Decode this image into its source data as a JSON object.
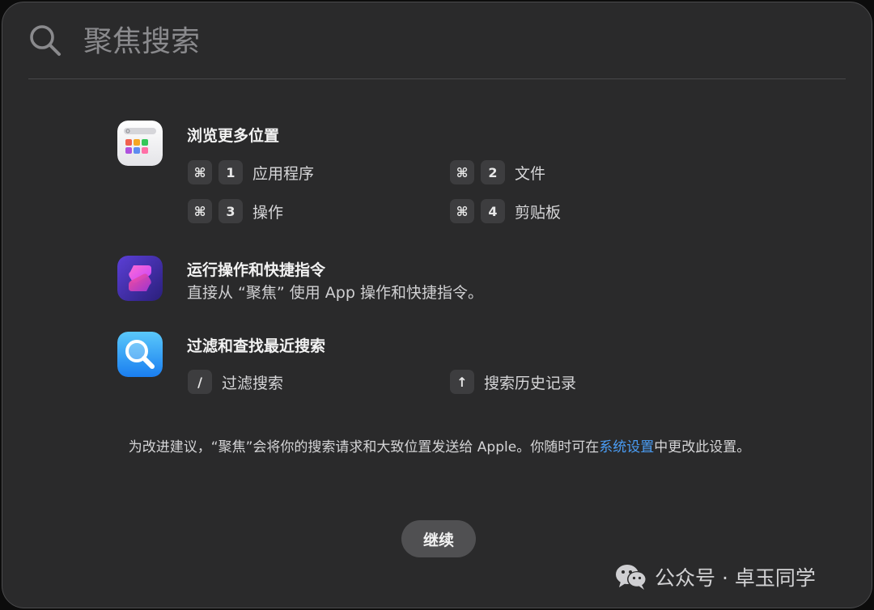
{
  "search": {
    "placeholder": "聚焦搜索"
  },
  "sections": {
    "browse": {
      "title": "浏览更多位置",
      "shortcuts": [
        {
          "modifier": "⌘",
          "key": "1",
          "label": "应用程序"
        },
        {
          "modifier": "⌘",
          "key": "2",
          "label": "文件"
        },
        {
          "modifier": "⌘",
          "key": "3",
          "label": "操作"
        },
        {
          "modifier": "⌘",
          "key": "4",
          "label": "剪贴板"
        }
      ]
    },
    "actions": {
      "title": "运行操作和快捷指令",
      "description": "直接从 “聚焦” 使用 App 操作和快捷指令。"
    },
    "filter": {
      "title": "过滤和查找最近搜索",
      "shortcuts": [
        {
          "key": "/",
          "label": "过滤搜索"
        },
        {
          "key": "↑",
          "label": "搜索历史记录"
        }
      ]
    }
  },
  "footer": {
    "notice_before": "为改进建议，“聚焦”会将你的搜索请求和大致位置发送给 Apple。你随时可在",
    "link": "系统设置",
    "notice_after": "中更改此设置。",
    "continue_label": "继续"
  },
  "watermark": {
    "text": "公众号 · 卓玉同学"
  },
  "icons": {
    "search": "search-icon",
    "browse": "browse-locations-app-icon",
    "shortcuts": "shortcuts-app-icon",
    "magnifier": "magnifier-app-icon",
    "wechat": "wechat-logo-icon"
  },
  "colors": {
    "window_bg": "#2a2a2b",
    "key_bg": "#3d3d3f",
    "link": "#4a9df5",
    "button_bg": "#505052"
  }
}
